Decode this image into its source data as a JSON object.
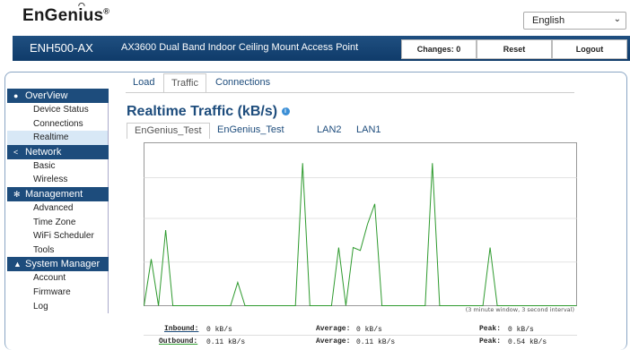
{
  "header": {
    "logo_text": "EnGenius",
    "logo_reg": "®",
    "language": "English",
    "model": "ENH500-AX",
    "description": "AX3600 Dual Band Indoor Ceiling Mount Access Point",
    "changes_label": "Changes: 0",
    "reset_label": "Reset",
    "logout_label": "Logout"
  },
  "sidebar": {
    "sections": [
      {
        "label": "OverView",
        "icon": "info-icon",
        "items": [
          "Device Status",
          "Connections",
          "Realtime"
        ]
      },
      {
        "label": "Network",
        "icon": "share-icon",
        "items": [
          "Basic",
          "Wireless"
        ]
      },
      {
        "label": "Management",
        "icon": "gear-icon",
        "items": [
          "Advanced",
          "Time Zone",
          "WiFi Scheduler",
          "Tools"
        ]
      },
      {
        "label": "System Manager",
        "icon": "user-icon",
        "items": [
          "Account",
          "Firmware",
          "Log"
        ]
      }
    ],
    "active_item": "Realtime"
  },
  "tabs": [
    "Load",
    "Traffic",
    "Connections"
  ],
  "active_tab": "Traffic",
  "page_title": "Realtime Traffic (kB/s)",
  "subtabs": [
    "EnGenius_Test",
    "EnGenius_Test",
    "LAN2",
    "LAN1"
  ],
  "active_subtab": 0,
  "chart_note": "(3 minute window, 3 second interval)",
  "stats": {
    "inbound_label": "Inbound:",
    "inbound_value": "0 kB/s",
    "outbound_label": "Outbound:",
    "outbound_value": "0.11 kB/s",
    "avg_label": "Average:",
    "avg_in": "0 kB/s",
    "avg_out": "0.11 kB/s",
    "peak_label": "Peak:",
    "peak_in": "0 kB/s",
    "peak_out": "0.54 kB/s"
  },
  "colors": {
    "accent": "#1d4c7c",
    "series": "#2e9a2e"
  },
  "chart_data": {
    "type": "line",
    "x_window_seconds": 180,
    "interval_seconds": 3,
    "ylim": [
      0,
      0.56
    ],
    "yticks": [
      0.15,
      0.3,
      0.44
    ],
    "grid": true,
    "series": [
      {
        "values": [
          0,
          0.16,
          0,
          0.26,
          0,
          0,
          0,
          0,
          0,
          0,
          0,
          0,
          0,
          0.08,
          0,
          0,
          0,
          0,
          0,
          0,
          0,
          0,
          0.49,
          0,
          0,
          0,
          0,
          0.2,
          0,
          0.2,
          0.19,
          0.28,
          0.35,
          0,
          0,
          0,
          0,
          0,
          0,
          0,
          0.49,
          0,
          0,
          0,
          0,
          0,
          0,
          0,
          0.2,
          0,
          0,
          0,
          0,
          0,
          0,
          0,
          0,
          0,
          0,
          0,
          0
        ]
      }
    ]
  }
}
